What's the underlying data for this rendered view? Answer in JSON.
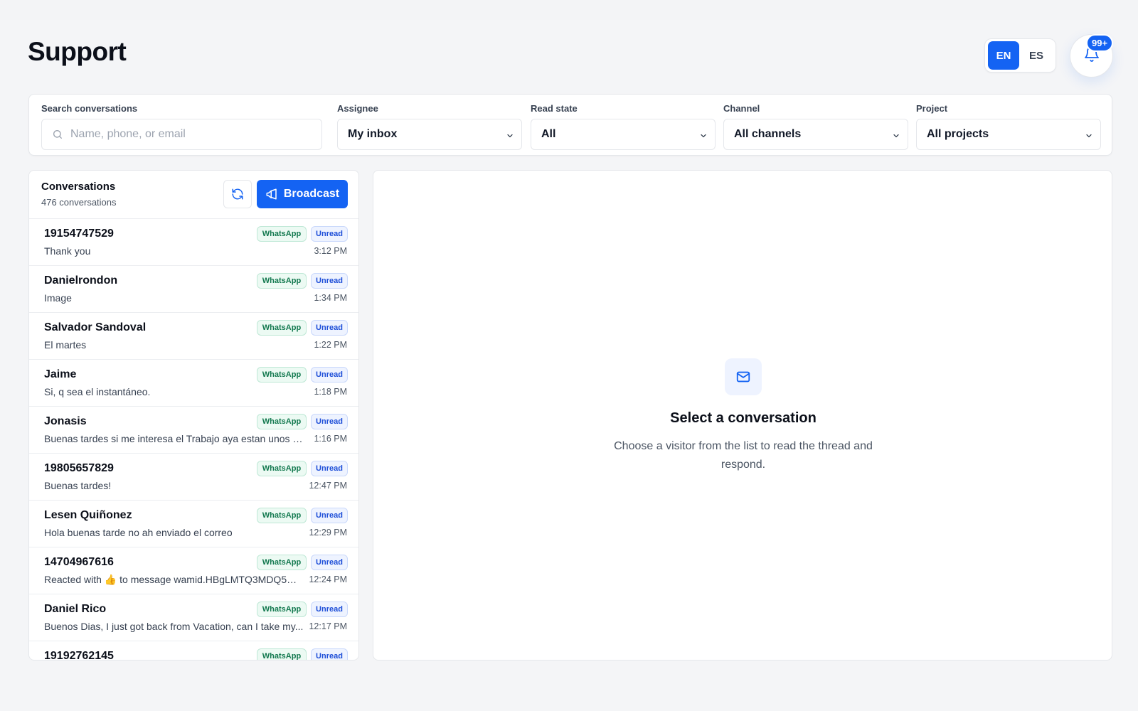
{
  "page": {
    "title": "Support"
  },
  "language": {
    "options": [
      "EN",
      "ES"
    ],
    "active": "EN"
  },
  "notifications": {
    "badge": "99+"
  },
  "filters": {
    "search": {
      "label": "Search conversations",
      "placeholder": "Name, phone, or email",
      "value": ""
    },
    "assignee": {
      "label": "Assignee",
      "value": "My inbox"
    },
    "read_state": {
      "label": "Read state",
      "value": "All"
    },
    "channel": {
      "label": "Channel",
      "value": "All channels"
    },
    "project": {
      "label": "Project",
      "value": "All projects"
    }
  },
  "conversations": {
    "title": "Conversations",
    "count": "476 conversations",
    "broadcast_label": "Broadcast",
    "items": [
      {
        "name": "19154747529",
        "preview": "Thank you",
        "time": "3:12 PM",
        "channel": "WhatsApp",
        "status": "Unread"
      },
      {
        "name": "Danielrondon",
        "preview": "Image",
        "time": "1:34 PM",
        "channel": "WhatsApp",
        "status": "Unread"
      },
      {
        "name": "Salvador Sandoval",
        "preview": "El martes",
        "time": "1:22 PM",
        "channel": "WhatsApp",
        "status": "Unread"
      },
      {
        "name": "Jaime",
        "preview": "Si, q sea el instantáneo.",
        "time": "1:18 PM",
        "channel": "WhatsApp",
        "status": "Unread"
      },
      {
        "name": "Jonasis",
        "preview": "Buenas tardes si me interesa el Trabajo aya estan unos a...",
        "time": "1:16 PM",
        "channel": "WhatsApp",
        "status": "Unread"
      },
      {
        "name": "19805657829",
        "preview": "Buenas tardes!",
        "time": "12:47 PM",
        "channel": "WhatsApp",
        "status": "Unread"
      },
      {
        "name": "Lesen Quiñonez",
        "preview": "Hola buenas tarde no ah enviado el correo",
        "time": "12:29 PM",
        "channel": "WhatsApp",
        "status": "Unread"
      },
      {
        "name": "14704967616",
        "preview": "Reacted with 👍 to message wamid.HBgLMTQ3MDQ5Nj...",
        "time": "12:24 PM",
        "channel": "WhatsApp",
        "status": "Unread"
      },
      {
        "name": "Daniel Rico",
        "preview": "Buenos Dias, I just got back from Vacation, can I take my...",
        "time": "12:17 PM",
        "channel": "WhatsApp",
        "status": "Unread"
      },
      {
        "name": "19192762145",
        "preview": "",
        "time": "",
        "channel": "WhatsApp",
        "status": "Unread"
      }
    ]
  },
  "detail": {
    "empty_title": "Select a conversation",
    "empty_description": "Choose a visitor from the list to read the thread and respond."
  },
  "colors": {
    "primary": "#1463f3",
    "whatsapp_text": "#13794f",
    "unread_text": "#1d4ed8"
  },
  "icons": {
    "search": "search-icon",
    "bell": "bell-icon",
    "refresh": "refresh-icon",
    "broadcast": "megaphone-icon",
    "mail": "mail-icon",
    "chevron": "chevron-down-icon"
  }
}
